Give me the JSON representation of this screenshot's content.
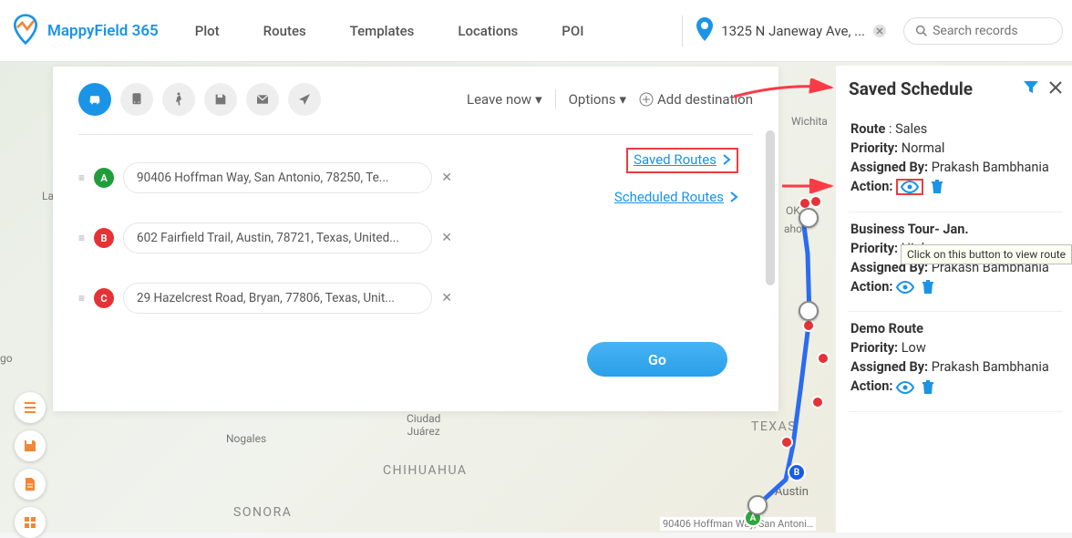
{
  "header": {
    "logo_text": "MappyField 365",
    "nav": [
      "Plot",
      "Routes",
      "Templates",
      "Locations",
      "POI"
    ],
    "location": "1325 N Janeway Ave, ...",
    "search_placeholder": "Search records"
  },
  "map": {
    "labels": {
      "texas": "TEXAS",
      "sonora": "SONORA",
      "chihuahua": "CHIHUAHUA",
      "ciudad": "Ciudad\nJuárez",
      "nogales": "Nogales",
      "austin": "Austin",
      "wichita": "Wichita",
      "laredo": "La",
      "okc1": "OK",
      "okc2": "aho",
      "hoffman": "90406 Hoffman Way, San Antoni…",
      "go": "go"
    }
  },
  "route_panel": {
    "leave_now": "Leave now",
    "options": "Options",
    "add_destination": "Add destination",
    "saved_routes": "Saved Routes",
    "scheduled_routes": "Scheduled Routes",
    "go": "Go",
    "stops": [
      {
        "marker": "A",
        "address": "90406 Hoffman Way, San Antonio, 78250, Te..."
      },
      {
        "marker": "B",
        "address": "602 Fairfield Trail, Austin, 78721, Texas, United..."
      },
      {
        "marker": "C",
        "address": "29 Hazelcrest Road, Bryan, 77806, Texas, Unit..."
      }
    ]
  },
  "side_panel": {
    "title": "Saved Schedule",
    "labels": {
      "route": "Route",
      "priority": "Priority:",
      "assigned": "Assigned By:",
      "action": "Action:"
    },
    "tooltip": "Click on this button to view route",
    "cards": [
      {
        "route": "Sales",
        "priority": "Normal",
        "assigned_by": "Prakash Bambhania"
      },
      {
        "route": "Business Tour- Jan.",
        "priority": "High",
        "assigned_by": "Prakash Bambhania"
      },
      {
        "route": "Demo Route",
        "priority": "Low",
        "assigned_by": "Prakash Bambhania"
      }
    ]
  }
}
